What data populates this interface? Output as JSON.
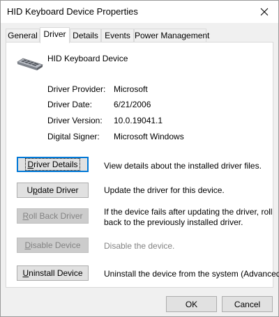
{
  "window": {
    "title": "HID Keyboard Device Properties"
  },
  "tabs": [
    {
      "label": "General"
    },
    {
      "label": "Driver"
    },
    {
      "label": "Details"
    },
    {
      "label": "Events"
    },
    {
      "label": "Power Management"
    }
  ],
  "active_tab": "Driver",
  "device": {
    "name": "HID Keyboard Device",
    "icon": "keyboard-icon"
  },
  "info": [
    {
      "label": "Driver Provider:",
      "value": "Microsoft"
    },
    {
      "label": "Driver Date:",
      "value": "6/21/2006"
    },
    {
      "label": "Driver Version:",
      "value": "10.0.19041.1"
    },
    {
      "label": "Digital Signer:",
      "value": "Microsoft Windows"
    }
  ],
  "actions": [
    {
      "label": "Driver Details",
      "accel": "D",
      "rest": "river Details",
      "enabled": true,
      "focused": true,
      "description": "View details about the installed driver files."
    },
    {
      "label": "Update Driver",
      "accel": "p",
      "pre": "U",
      "rest": "date Driver",
      "enabled": true,
      "description": "Update the driver for this device."
    },
    {
      "label": "Roll Back Driver",
      "accel": "R",
      "rest": "oll Back Driver",
      "enabled": false,
      "description_line1": "If the device fails after updating the driver, roll",
      "description_line2": "back to the previously installed driver."
    },
    {
      "label": "Disable Device",
      "accel": "D",
      "rest": "isable Device",
      "enabled": false,
      "description": "Disable the device."
    },
    {
      "label": "Uninstall Device",
      "accel": "U",
      "rest": "ninstall Device",
      "enabled": true,
      "description": "Uninstall the device from the system (Advanced)."
    }
  ],
  "footer": {
    "ok_label": "OK",
    "cancel_label": "Cancel"
  },
  "colors": {
    "focus_border": "#0078d7",
    "disabled_text": "#838383",
    "button_face": "#e1e1e1"
  }
}
